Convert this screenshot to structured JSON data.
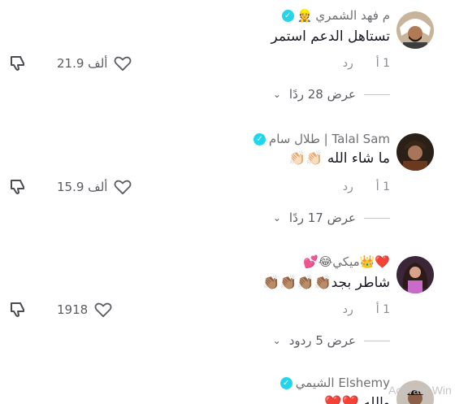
{
  "comments": [
    {
      "username": "م فهد الشمري",
      "user_emoji": "👷",
      "verified": true,
      "text": "تستاهل الدعم استمر",
      "time": "1 أ",
      "reply_label": "رد",
      "likes": "21.9 ألف",
      "view_replies": "عرض 28 ردًا"
    },
    {
      "username": "Talal Sam | طلال سام",
      "verified": true,
      "text": "ما شاء الله 👏🏻👏🏻",
      "time": "1 أ",
      "reply_label": "رد",
      "likes": "15.9 ألف",
      "view_replies": "عرض 17 ردًا"
    },
    {
      "username": "❤️👑ميكي😂💕",
      "verified": false,
      "text": "شاطر بجد👏🏽👏🏽👏🏽👏🏽",
      "time": "1 أ",
      "reply_label": "رد",
      "likes": "1918",
      "view_replies": "عرض 5 ردود"
    },
    {
      "username": "Elshemy الشيمي",
      "verified": true,
      "text": "والله ❤️❤️"
    }
  ],
  "watermark": "Activate Win"
}
